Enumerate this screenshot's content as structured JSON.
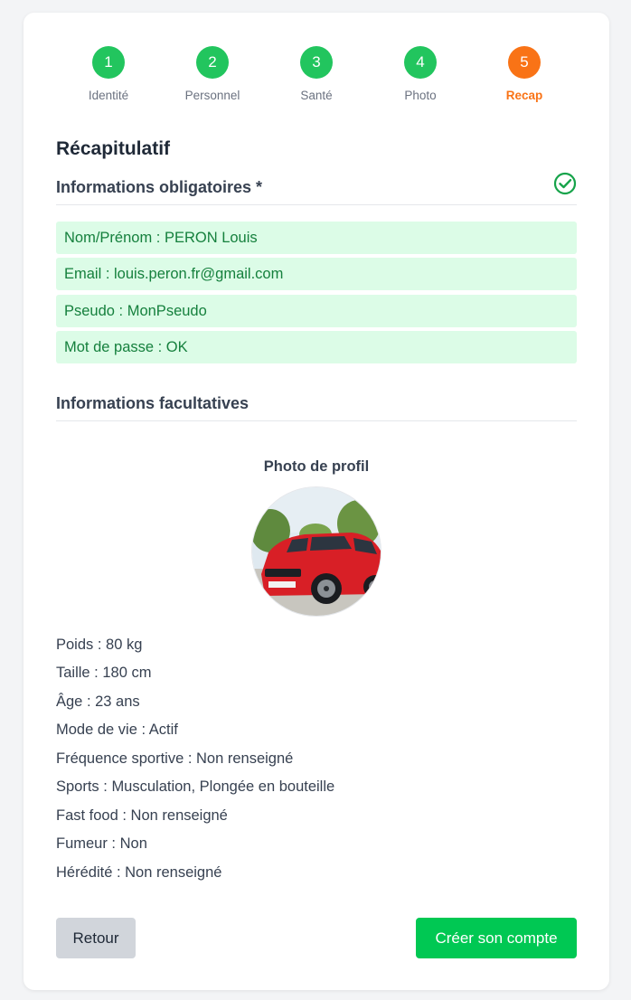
{
  "stepper": {
    "steps": [
      {
        "number": "1",
        "label": "Identité",
        "color": "#22c55e"
      },
      {
        "number": "2",
        "label": "Personnel",
        "color": "#22c55e"
      },
      {
        "number": "3",
        "label": "Santé",
        "color": "#22c55e"
      },
      {
        "number": "4",
        "label": "Photo",
        "color": "#22c55e"
      },
      {
        "number": "5",
        "label": "Recap",
        "color": "#f97316"
      }
    ]
  },
  "title": "Récapitulatif",
  "required": {
    "heading": "Informations obligatoires *",
    "items": [
      "Nom/Prénom : PERON Louis",
      "Email : louis.peron.fr@gmail.com",
      "Pseudo : MonPseudo",
      "Mot de passe : OK"
    ],
    "status_color": "#16a34a"
  },
  "optional": {
    "heading": "Informations facultatives",
    "photo_label": "Photo de profil",
    "items": [
      "Poids : 80 kg",
      "Taille : 180 cm",
      "Âge : 23 ans",
      "Mode de vie : Actif",
      "Fréquence sportive : Non renseigné",
      "Sports : Musculation, Plongée en bouteille",
      "Fast food : Non renseigné",
      "Fumeur : Non",
      "Hérédité : Non renseigné"
    ]
  },
  "buttons": {
    "back": "Retour",
    "create": "Créer son compte"
  }
}
